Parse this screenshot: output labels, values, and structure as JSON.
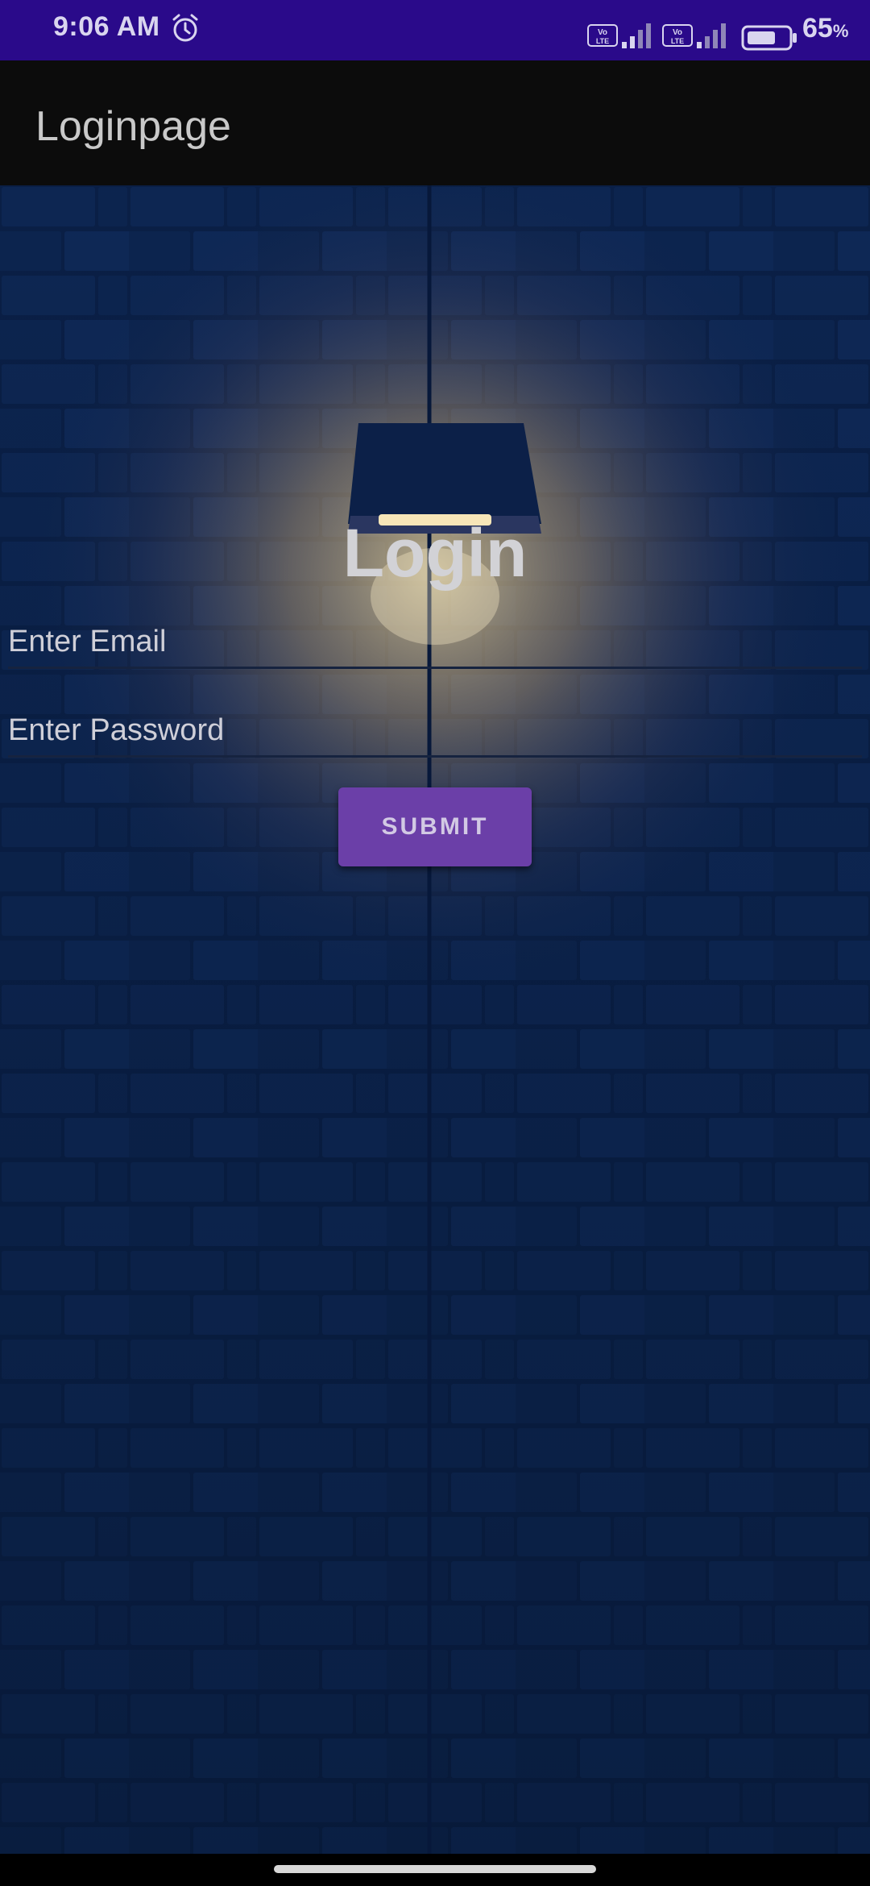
{
  "status_bar": {
    "time": "9:06 AM",
    "battery_percent": "65",
    "battery_unit": "%",
    "volte_label": "Vo LTE",
    "icons": [
      "alarm-icon",
      "volte-icon",
      "signal-icon",
      "volte-icon",
      "signal-icon",
      "battery-icon"
    ]
  },
  "app_bar": {
    "title": "Loginpage"
  },
  "login": {
    "heading": "Login",
    "email_placeholder": "Enter Email",
    "email_value": "",
    "password_placeholder": "Enter Password",
    "password_value": "",
    "submit_label": "SUBMIT"
  },
  "colors": {
    "status_bar": "#2a0a8a",
    "app_bar": "#0c0c0c",
    "wall": "#071a3c",
    "button": "#6b3fa8",
    "text": "#d2d2d6"
  }
}
